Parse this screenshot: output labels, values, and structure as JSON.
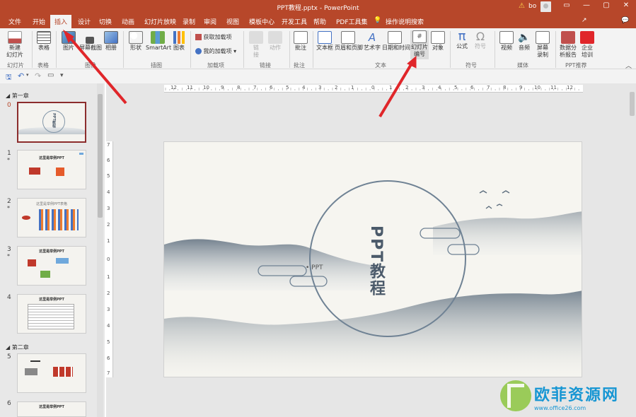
{
  "titlebar": {
    "title": "PPT教程.pptx  -  PowerPoint",
    "user": "bo",
    "warning_icon": "⚠"
  },
  "tabs": [
    "文件",
    "开始",
    "插入",
    "设计",
    "切换",
    "动画",
    "幻灯片放映",
    "录制",
    "审阅",
    "视图",
    "模板中心",
    "开发工具",
    "帮助",
    "PDF工具集",
    "操作说明搜索"
  ],
  "active_tab": "插入",
  "ribbon": {
    "new_slide_line1": "新建",
    "new_slide_line2": "幻灯片",
    "table": "表格",
    "image": "图片",
    "screenshot": "屏幕截图",
    "album": "相册",
    "shapes": "形状",
    "smartart": "SmartArt",
    "chart": "图表",
    "get_addins": "获取加载项",
    "my_addins": "我的加载项",
    "link_line1": "链",
    "link_line2": "接",
    "action": "动作",
    "comment": "批注",
    "textbox_line1": "文本框",
    "header_footer": "页眉和页脚",
    "wordart": "艺术字",
    "datetime": "日期和时间",
    "slide_number_line1": "幻灯片",
    "slide_number_line2": "编号",
    "object": "对象",
    "equation": "公式",
    "symbol": "符号",
    "video": "视频",
    "audio": "音频",
    "screen_rec_line1": "屏幕",
    "screen_rec_line2": "录制",
    "data_report_line1": "数据分",
    "data_report_line2": "析报告",
    "corp_training_line1": "企业",
    "corp_training_line2": "培训",
    "groups": {
      "slides": "幻灯片",
      "tables": "表格",
      "images": "图像",
      "illustrations": "插图",
      "addins": "加载项",
      "links": "链接",
      "comments": "批注",
      "text": "文本",
      "symbols": "符号",
      "media": "媒体",
      "ppt_recommend": "PPT推荐"
    }
  },
  "nav": {
    "section1": "第一章",
    "section2": "第二章",
    "slides": [
      {
        "num": "0",
        "star": "",
        "title": "PPT教程"
      },
      {
        "num": "1",
        "star": "*",
        "title": "这里是举例PPT"
      },
      {
        "num": "2",
        "star": "*",
        "title": "这里是举例PPT表格"
      },
      {
        "num": "3",
        "star": "*",
        "title": "这里是举例PPT"
      },
      {
        "num": "4",
        "star": "",
        "title": "这里是举例PPT"
      },
      {
        "num": "5",
        "star": "",
        "title": ""
      },
      {
        "num": "6",
        "star": "",
        "title": "这里是举例PPT"
      }
    ]
  },
  "ruler": {
    "h_numbers": [
      "12",
      "11",
      "10",
      "9",
      "8",
      "7",
      "6",
      "5",
      "4",
      "3",
      "2",
      "1",
      "0",
      "1",
      "2",
      "3",
      "4",
      "5",
      "6",
      "7",
      "8",
      "9",
      "10",
      "11",
      "12"
    ],
    "v_numbers": [
      "7",
      "6",
      "5",
      "4",
      "3",
      "2",
      "1",
      "0",
      "1",
      "2",
      "3",
      "4",
      "5",
      "6",
      "7"
    ]
  },
  "slide": {
    "title": "PPT教程",
    "subtitle": "• PPT"
  },
  "watermark": {
    "text": "欧菲资源网",
    "url": "www.office26.com"
  },
  "colors": {
    "accent": "#b7472a",
    "arrow": "#e0262a",
    "slide_text": "#4b5a6a",
    "watermark": "#1796d3"
  }
}
